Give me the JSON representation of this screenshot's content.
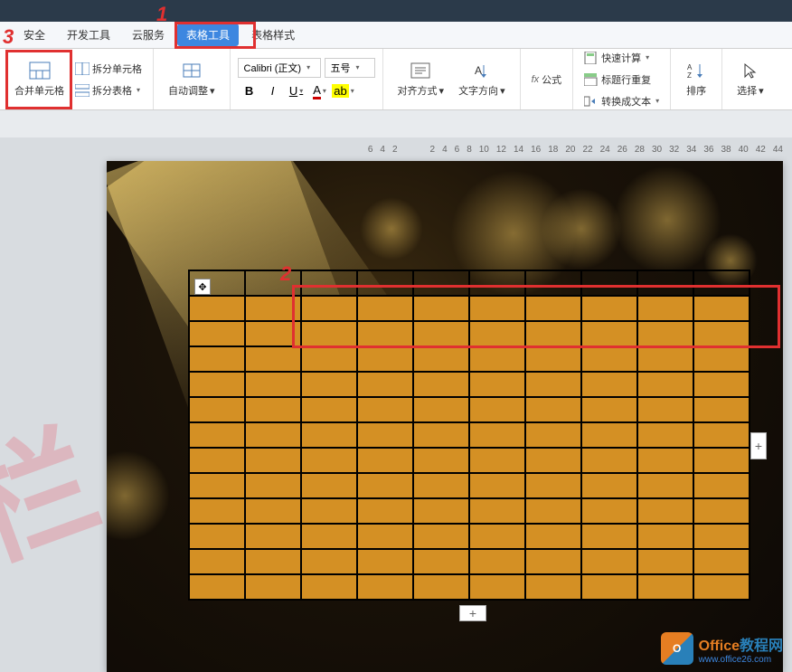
{
  "menu": {
    "security": "安全",
    "devtools": "开发工具",
    "cloud": "云服务",
    "table_tools": "表格工具",
    "table_style": "表格样式"
  },
  "ribbon": {
    "merge_cell": "合并单元格",
    "split_cell": "拆分单元格",
    "split_table": "拆分表格",
    "auto_fit": "自动调整",
    "font_name": "Calibri (正文)",
    "font_size": "五号",
    "align": "对齐方式",
    "text_dir": "文字方向",
    "formula": "公式",
    "formula_prefix": "fx",
    "quick_calc": "快速计算",
    "repeat_header": "标题行重复",
    "convert_text": "转换成文本",
    "sort": "排序",
    "select": "选择"
  },
  "ruler": [
    "6",
    "4",
    "2",
    "",
    "2",
    "4",
    "6",
    "8",
    "10",
    "12",
    "14",
    "16",
    "18",
    "20",
    "22",
    "24",
    "26",
    "28",
    "30",
    "32",
    "34",
    "36",
    "38",
    "40",
    "42",
    "44"
  ],
  "annotations": {
    "a1": "1",
    "a2": "2",
    "a3": "3"
  },
  "footer": {
    "title": "Office教程网",
    "url": "www.office26.com",
    "logo_text": "O"
  },
  "handles": {
    "move": "✥",
    "plus": "+"
  }
}
